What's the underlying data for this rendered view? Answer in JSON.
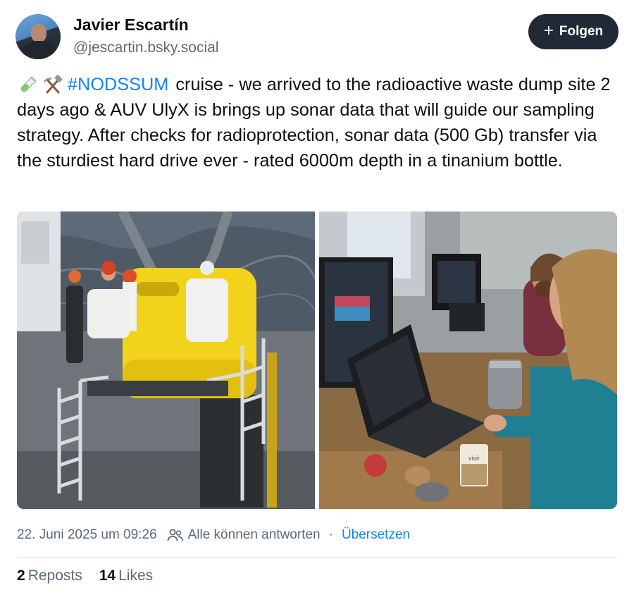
{
  "author": {
    "display_name": "Javier Escartín",
    "handle": "@jescartin.bsky.social"
  },
  "follow_button": {
    "label": "Folgen"
  },
  "post": {
    "emoji": [
      "test-tube-emoji",
      "hammer-and-pick-emoji"
    ],
    "hashtag": "#NODSSUM",
    "text": "cruise - we arrived to the radioactive waste dump site 2 days ago & AUV UlyX is brings up sonar data that will guide our sampling strategy. After checks for radioprotection, sonar data (500 Gb) transfer via the sturdiest hard drive ever - rated 6000m depth in a tinanium bottle."
  },
  "images": [
    {
      "name": "auv-on-deck-photo"
    },
    {
      "name": "lab-computers-photo",
      "label": "vivir"
    }
  ],
  "meta": {
    "timestamp": "22. Juni 2025 um 09:26",
    "reply_setting": "Alle können antworten",
    "separator": "·",
    "translate": "Übersetzen"
  },
  "stats": {
    "reposts_count": "2",
    "reposts_label": "Reposts",
    "likes_count": "14",
    "likes_label": "Likes"
  },
  "colors": {
    "link": "#1083fe",
    "muted": "#5b6b7c",
    "follow_bg": "#1f2a36",
    "auv_yellow": "#f2d21a"
  }
}
